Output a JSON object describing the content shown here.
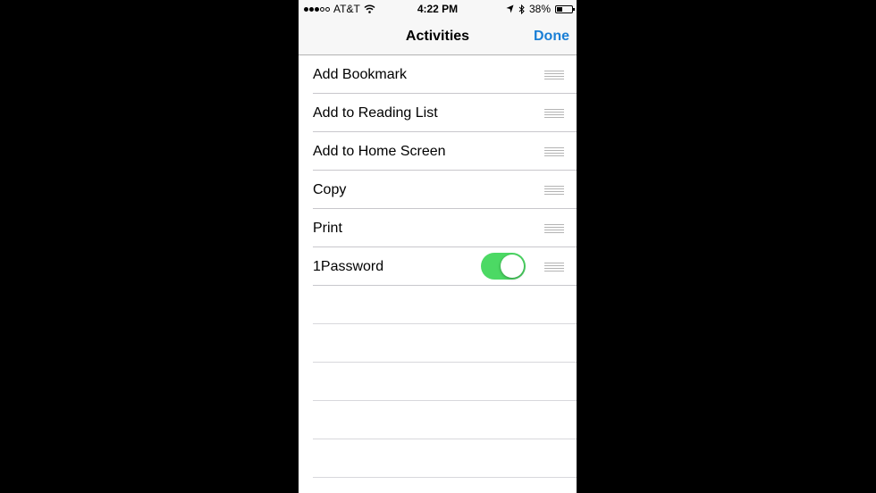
{
  "status_bar": {
    "carrier": "AT&T",
    "time": "4:22 PM",
    "battery_percent": "38%",
    "battery_level": 0.38,
    "signal_dots_filled": 3,
    "signal_dots_total": 5,
    "icons": [
      "wifi-icon",
      "location-arrow-icon",
      "bluetooth-icon",
      "battery-icon"
    ]
  },
  "nav": {
    "title": "Activities",
    "done_label": "Done"
  },
  "activities": [
    {
      "label": "Add Bookmark"
    },
    {
      "label": "Add to Reading List"
    },
    {
      "label": "Add to Home Screen"
    },
    {
      "label": "Copy"
    },
    {
      "label": "Print"
    },
    {
      "label": "1Password",
      "toggle_on": true
    }
  ],
  "colors": {
    "accent": "#1a7fd6",
    "toggle_on": "#4cd964"
  }
}
